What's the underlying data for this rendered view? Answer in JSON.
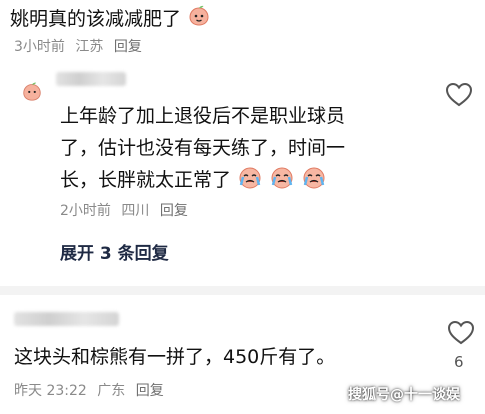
{
  "comment1": {
    "text": "姚明真的该减减肥了",
    "time": "3小时前",
    "location": "江苏",
    "reply_label": "回复"
  },
  "reply1": {
    "line1": "上年龄了加上退役后不是职业球员",
    "line2": "了，估计也没有每天练了，时间一",
    "line3": "长，长胖就太正常了",
    "time": "2小时前",
    "location": "四川",
    "reply_label": "回复",
    "expand_label": "展开 3 条回复"
  },
  "comment2": {
    "text": "这块头和棕熊有一拼了，450斤有了。",
    "time": "昨天 23:22",
    "location": "广东",
    "reply_label": "回复",
    "like_count": "6"
  },
  "watermark": "搜狐号@十一谈娱",
  "colors": {
    "text": "#111111",
    "meta": "#8a8a8a",
    "expand": "#1f2a44",
    "divider": "#f3f3f3",
    "peach": "#f4a48c"
  },
  "icons": [
    "peach-emoji",
    "crying-emoji",
    "heart-outline-icon"
  ]
}
